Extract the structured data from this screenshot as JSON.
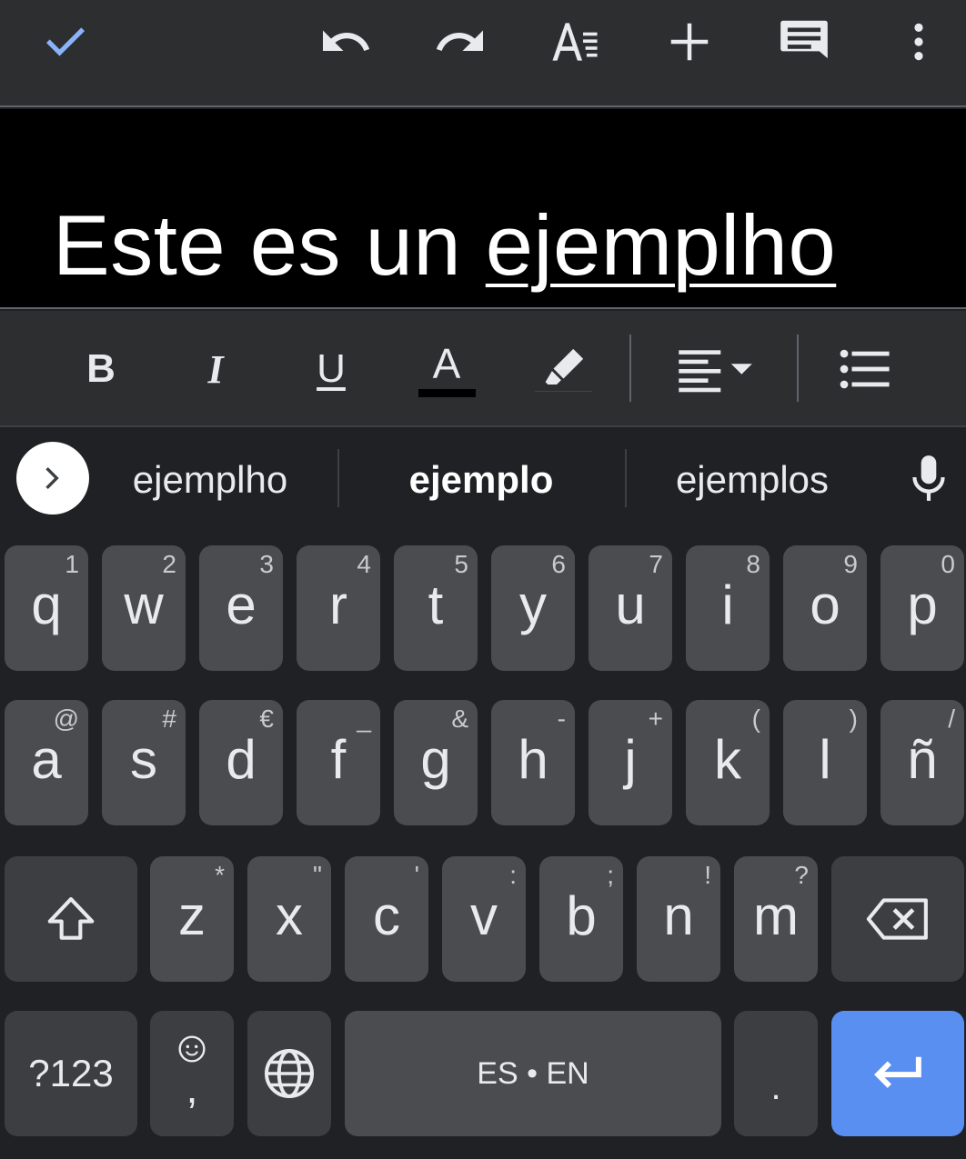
{
  "toolbar": {
    "icons": [
      "done-check-icon",
      "undo-icon",
      "redo-icon",
      "text-format-icon",
      "insert-plus-icon",
      "comment-icon",
      "more-vert-icon"
    ]
  },
  "document": {
    "text_before": "Este es un ",
    "misspelled_word": "ejemplho"
  },
  "format_bar": {
    "bold": "B",
    "italic": "I",
    "underline": "U",
    "text_color": "A",
    "text_color_swatch": "#000000"
  },
  "suggestions": {
    "items": [
      "ejemplho",
      "ejemplo",
      "ejemplos"
    ],
    "selected_index": 1
  },
  "keyboard": {
    "row1": [
      {
        "key": "q",
        "hint": "1"
      },
      {
        "key": "w",
        "hint": "2"
      },
      {
        "key": "e",
        "hint": "3"
      },
      {
        "key": "r",
        "hint": "4"
      },
      {
        "key": "t",
        "hint": "5"
      },
      {
        "key": "y",
        "hint": "6"
      },
      {
        "key": "u",
        "hint": "7"
      },
      {
        "key": "i",
        "hint": "8"
      },
      {
        "key": "o",
        "hint": "9"
      },
      {
        "key": "p",
        "hint": "0"
      }
    ],
    "row2": [
      {
        "key": "a",
        "hint": "@"
      },
      {
        "key": "s",
        "hint": "#"
      },
      {
        "key": "d",
        "hint": "€"
      },
      {
        "key": "f",
        "hint": "_"
      },
      {
        "key": "g",
        "hint": "&"
      },
      {
        "key": "h",
        "hint": "-"
      },
      {
        "key": "j",
        "hint": "+"
      },
      {
        "key": "k",
        "hint": "("
      },
      {
        "key": "l",
        "hint": ")"
      },
      {
        "key": "ñ",
        "hint": "/"
      }
    ],
    "row3": [
      {
        "key": "z",
        "hint": "*"
      },
      {
        "key": "x",
        "hint": "\""
      },
      {
        "key": "c",
        "hint": "'"
      },
      {
        "key": "v",
        "hint": ":"
      },
      {
        "key": "b",
        "hint": ";"
      },
      {
        "key": "n",
        "hint": "!"
      },
      {
        "key": "m",
        "hint": "?"
      }
    ],
    "symbols_label": "?123",
    "comma_label": ",",
    "space_label": "ES • EN",
    "period_label": ".",
    "enter_color": "#5a8ff2",
    "accent_color": "#8ab4f8"
  }
}
